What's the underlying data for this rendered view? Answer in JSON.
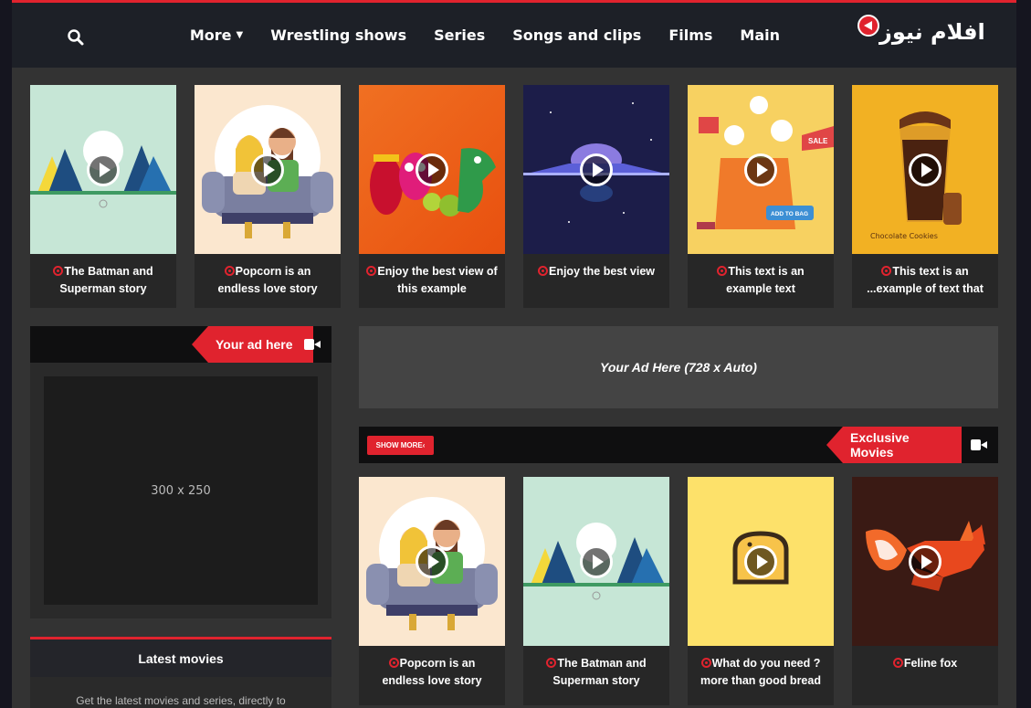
{
  "header": {
    "logo_text": "افلام نيوز",
    "nav": [
      "More",
      "Wrestling shows",
      "Series",
      "Songs and clips",
      "Films",
      "Main"
    ]
  },
  "top_cards": [
    {
      "title": "The Batman and Superman story",
      "thumb": "batman-superman"
    },
    {
      "title": "Popcorn is an endless love story",
      "thumb": "couple-sofa"
    },
    {
      "title": "Enjoy the best view of this example",
      "thumb": "toys"
    },
    {
      "title": "Enjoy the best view",
      "thumb": "ufo"
    },
    {
      "title": "This text is an example text",
      "thumb": "shopping"
    },
    {
      "title": "This text is an ...example of text that",
      "thumb": "chocolate"
    }
  ],
  "sidebar": {
    "ad_tag": "Your ad here",
    "ad_size": "300 x 250",
    "latest_title": "Latest movies",
    "latest_text": "Get the latest movies and series, directly to"
  },
  "ad_wide": "Your Ad Here (728 x Auto)",
  "exclusive": {
    "tag": "Exclusive Movies",
    "show_more": "SHOW MORE‹",
    "cards": [
      {
        "title": "Popcorn is an endless love story",
        "thumb": "couple-sofa"
      },
      {
        "title": "The Batman and Superman story",
        "thumb": "batman-superman"
      },
      {
        "title": "What do you need ?more than good bread",
        "thumb": "bread"
      },
      {
        "title": "Feline fox",
        "thumb": "fox"
      }
    ]
  },
  "thumb_text": {
    "chocolate": "Chocolate Cookies",
    "bag": "ADD TO BAG",
    "sale": "SALE"
  },
  "colors": {
    "accent": "#e0232e",
    "page_bg": "#333333",
    "header_bg": "#1d2027"
  }
}
